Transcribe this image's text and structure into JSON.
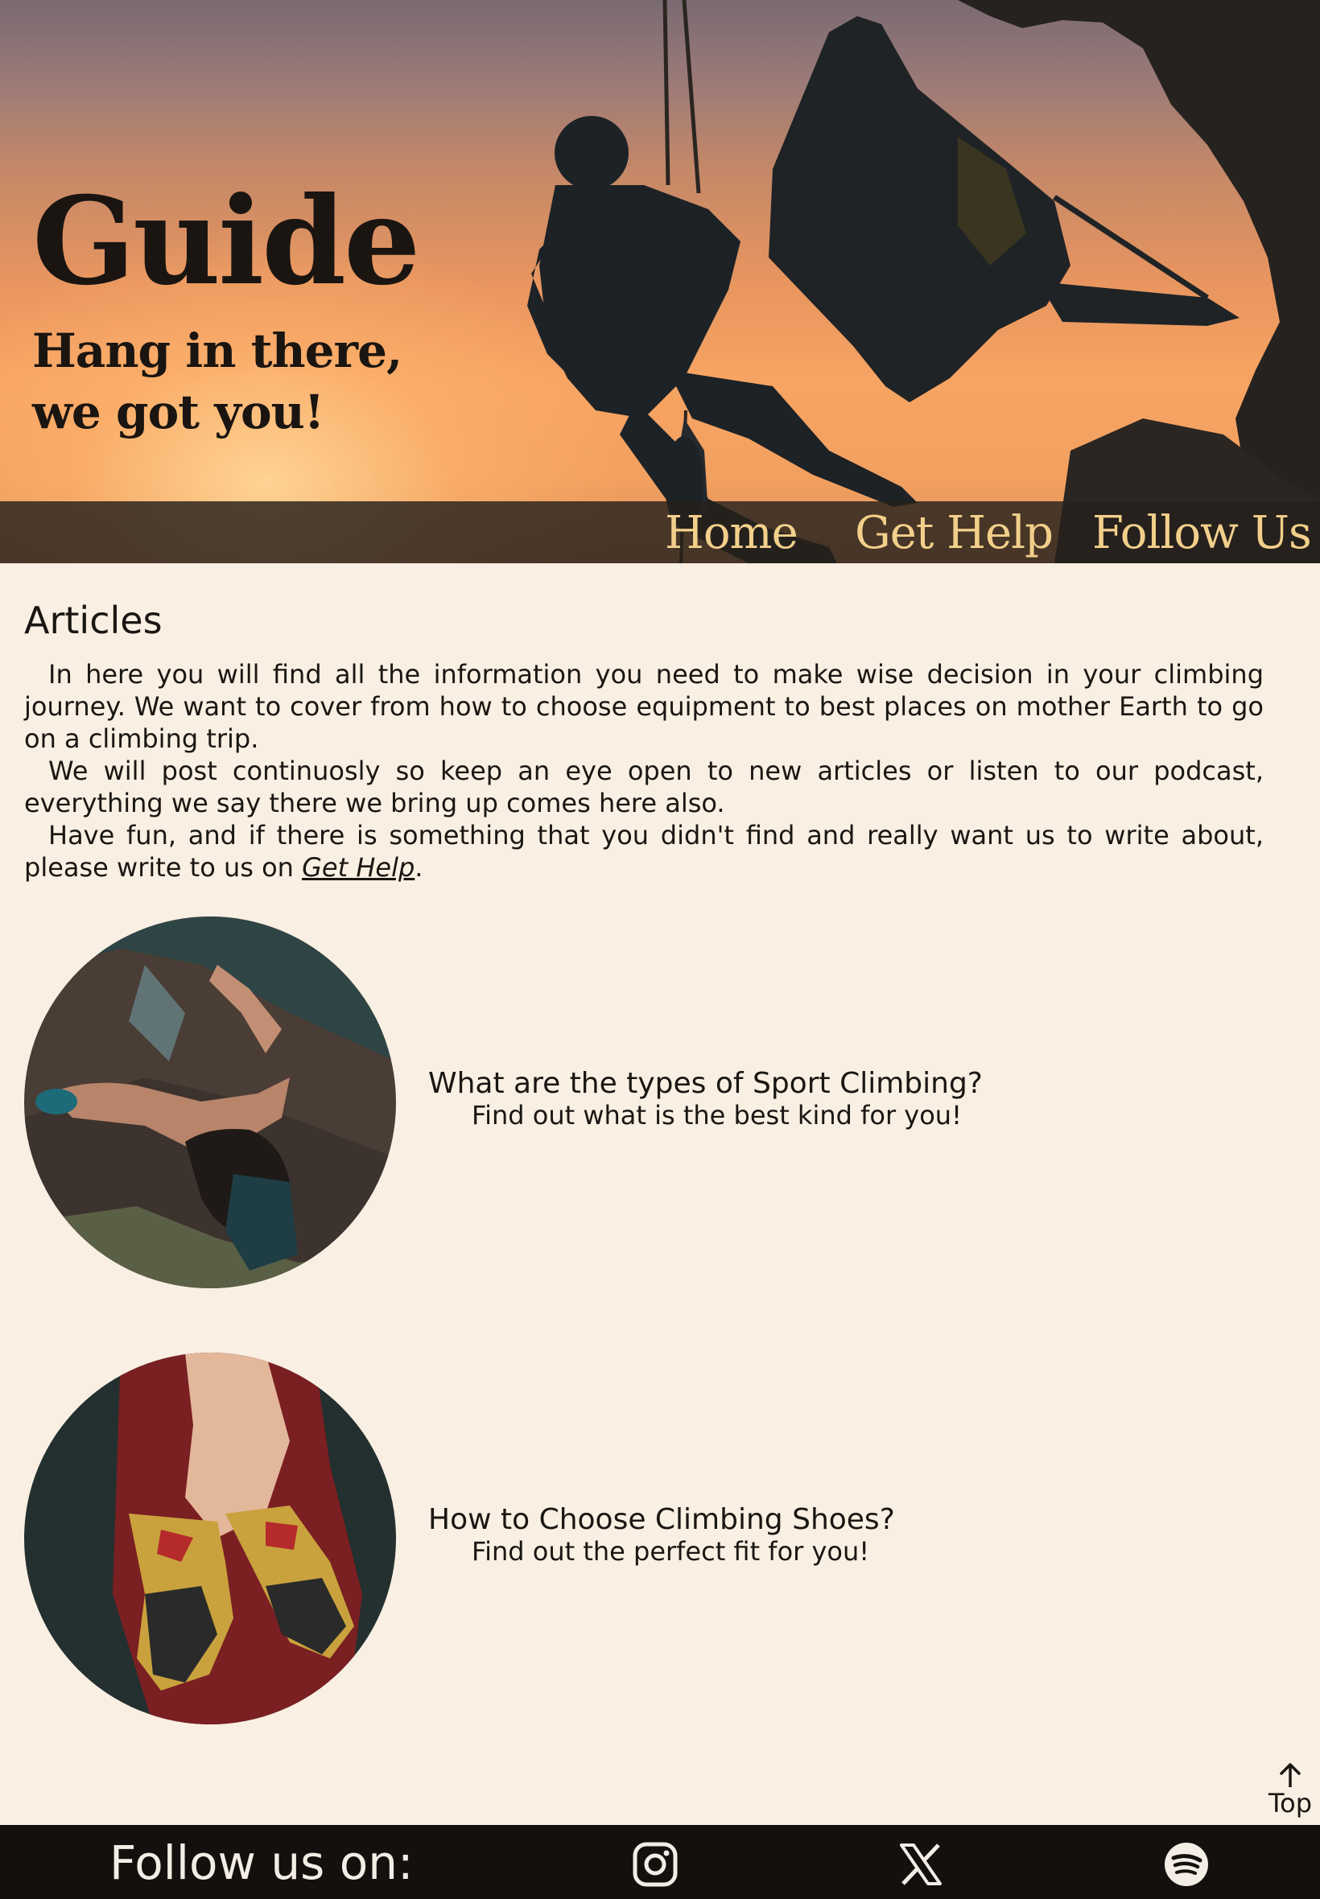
{
  "hero": {
    "title": "Guide",
    "subtitle": "Hang in there, we got you!"
  },
  "nav": {
    "items": [
      "Home",
      "Get Help",
      "Follow Us"
    ]
  },
  "articles": {
    "heading": "Articles",
    "intro": {
      "p1": "In here you will find all the information you need to make wise decision in your climbing journey. We want to cover from how to choose equipment to best places on mother Earth to go on a climbing trip.",
      "p2": "We will post continuosly so keep an eye open to new articles or listen to our podcast, everything we say there we bring up comes here also.",
      "p3_before": "Have fun, and if there is something that you didn't find and really want us to write about, please write to us on ",
      "p3_link": "Get Help",
      "p3_after": "."
    },
    "cards": [
      {
        "title": "What are the types of Sport Climbing?",
        "description": "Find out what is the best kind for you!"
      },
      {
        "title": "How to Choose Climbing Shoes?",
        "description": "Find out the perfect fit for you!"
      }
    ]
  },
  "back_to_top": {
    "label": "Top",
    "icon": "arrow-up-icon"
  },
  "footer": {
    "label": "Follow us on:",
    "social": [
      "instagram-icon",
      "x-icon",
      "spotify-icon"
    ]
  },
  "colors": {
    "background": "#f9efe2",
    "nav_link": "#f2cf8a",
    "footer_bg": "#13100e",
    "text": "#1a1613"
  }
}
